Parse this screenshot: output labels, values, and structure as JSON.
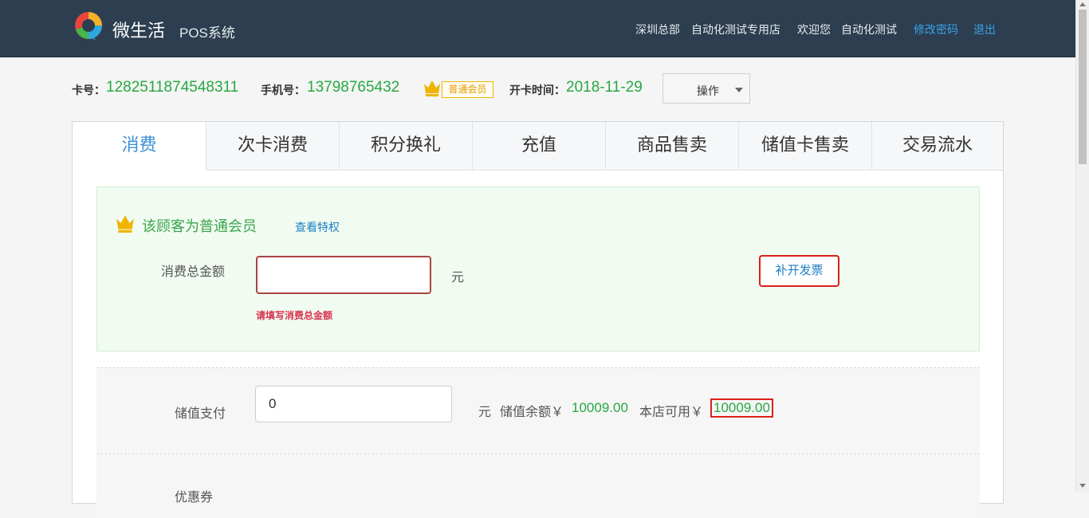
{
  "header": {
    "brand": "微生活",
    "subbrand": "POS系统",
    "store_group": "深圳总部",
    "store_name": "自动化测试专用店",
    "welcome": "欢迎您",
    "username": "自动化测试",
    "change_password": "修改密码",
    "logout": "退出"
  },
  "member": {
    "card_label": "卡号：",
    "card_no": "1282511874548311",
    "phone_label": "手机号：",
    "phone": "13798765432",
    "level_badge": "普通会员",
    "open_label": "开卡时间：",
    "open_date": "2018-11-29",
    "operation": "操作"
  },
  "tabs": [
    "消费",
    "次卡消费",
    "积分换礼",
    "充值",
    "商品售卖",
    "储值卡售卖",
    "交易流水"
  ],
  "consume": {
    "member_note": "该顾客为普通会员",
    "view_privilege": "查看特权",
    "total_label": "消费总金额",
    "total_value": "",
    "unit": "元",
    "error": "请填写消费总金额",
    "invoice_button": "补开发票"
  },
  "stored": {
    "label": "储值支付",
    "value": "0",
    "unit": "元",
    "balance_label": "储值余额￥",
    "balance": "10009.00",
    "available_label": "本店可用￥",
    "available": "10009.00"
  },
  "coupon": {
    "label": "优惠券"
  },
  "colors": {
    "header_bg": "#2c3e4f",
    "accent_green": "#27a844",
    "link_blue": "#3aa3e8",
    "error_red": "#d9201c",
    "crown_gold": "#f0b400"
  }
}
